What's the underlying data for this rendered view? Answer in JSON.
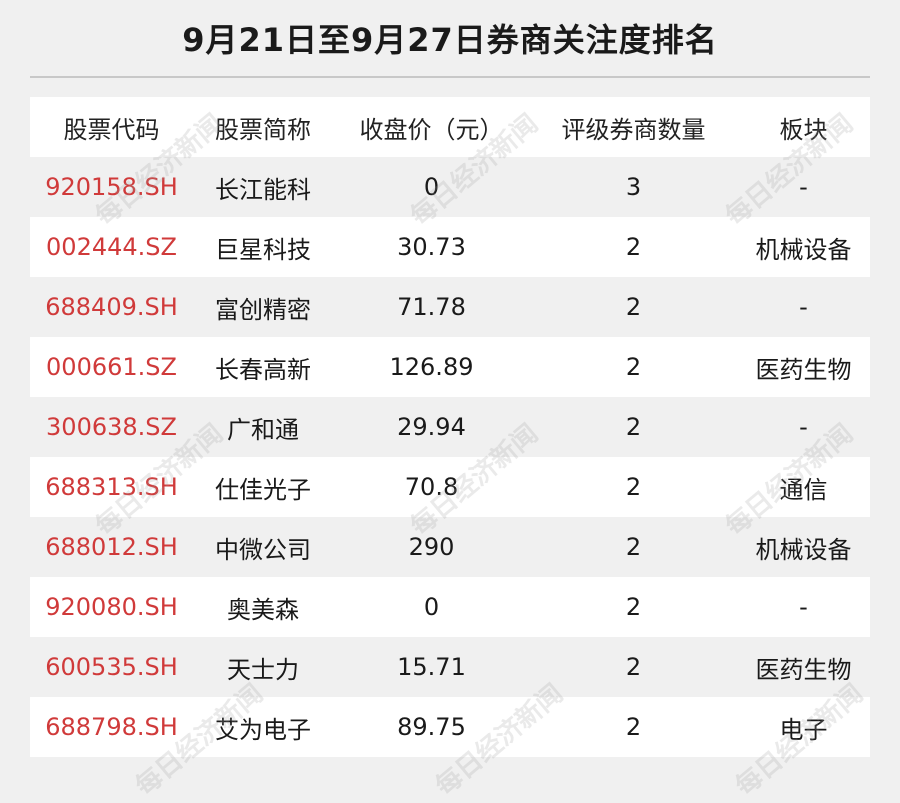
{
  "title": "9月21日至9月27日券商关注度排名",
  "watermark": "每日经济新闻",
  "table": {
    "headers": [
      "股票代码",
      "股票简称",
      "收盘价（元）",
      "评级券商数量",
      "板块"
    ],
    "rows": [
      {
        "code": "920158.SH",
        "name": "长江能科",
        "price": "0",
        "brokers": "3",
        "sector": "-"
      },
      {
        "code": "002444.SZ",
        "name": "巨星科技",
        "price": "30.73",
        "brokers": "2",
        "sector": "机械设备"
      },
      {
        "code": "688409.SH",
        "name": "富创精密",
        "price": "71.78",
        "brokers": "2",
        "sector": "-"
      },
      {
        "code": "000661.SZ",
        "name": "长春高新",
        "price": "126.89",
        "brokers": "2",
        "sector": "医药生物"
      },
      {
        "code": "300638.SZ",
        "name": "广和通",
        "price": "29.94",
        "brokers": "2",
        "sector": "-"
      },
      {
        "code": "688313.SH",
        "name": "仕佳光子",
        "price": "70.8",
        "brokers": "2",
        "sector": "通信"
      },
      {
        "code": "688012.SH",
        "name": "中微公司",
        "price": "290",
        "brokers": "2",
        "sector": "机械设备"
      },
      {
        "code": "920080.SH",
        "name": "奥美森",
        "price": "0",
        "brokers": "2",
        "sector": "-"
      },
      {
        "code": "600535.SH",
        "name": "天士力",
        "price": "15.71",
        "brokers": "2",
        "sector": "医药生物"
      },
      {
        "code": "688798.SH",
        "name": "艾为电子",
        "price": "89.75",
        "brokers": "2",
        "sector": "电子"
      }
    ]
  }
}
